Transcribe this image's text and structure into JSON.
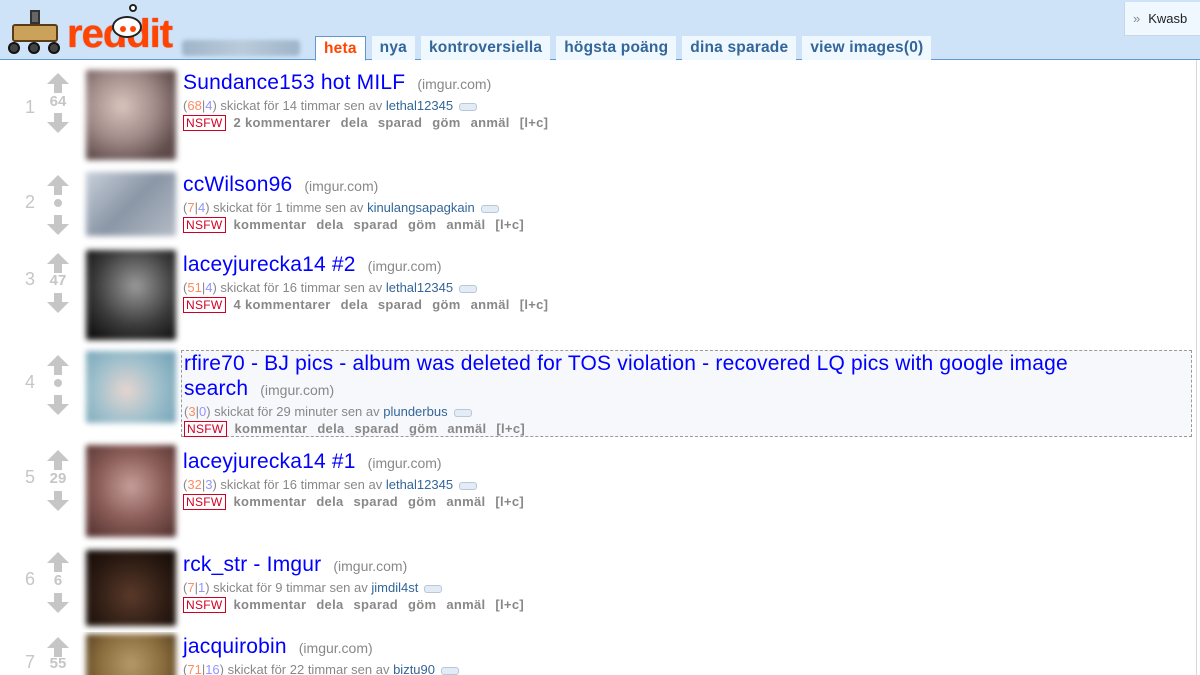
{
  "header": {
    "logo_text": "reddit",
    "tabs": [
      {
        "label": "heta",
        "selected": true
      },
      {
        "label": "nya",
        "selected": false
      },
      {
        "label": "kontroversiella",
        "selected": false
      },
      {
        "label": "högsta poäng",
        "selected": false
      },
      {
        "label": "dina sparade",
        "selected": false
      },
      {
        "label": "view images(0)",
        "selected": false
      }
    ],
    "user_chevron": "»",
    "user_name": "Kwasb"
  },
  "colors": {
    "header_bg": "#cee3f8",
    "link": "#0000ff",
    "nsfw": "#d10023",
    "selected_tab": "#ff4500"
  },
  "icons": {
    "upvote": "arrow-up-icon",
    "downvote": "arrow-down-icon",
    "flair": "tag-icon"
  },
  "posts": [
    {
      "rank": "1",
      "score": "64",
      "title": "Sundance153 hot MILF",
      "domain": "(imgur.com)",
      "ups": "68",
      "downs": "4",
      "time": "skickat för 14 timmar sen av",
      "author": "lethal12345",
      "nsfw": "NSFW",
      "comments": "2 kommentarer",
      "buttons": [
        "dela",
        "sparad",
        "göm",
        "anmäl",
        "[l+c]"
      ]
    },
    {
      "rank": "2",
      "score": "",
      "title": "ccWilson96",
      "domain": "(imgur.com)",
      "ups": "7",
      "downs": "4",
      "time": "skickat för 1 timme sen av",
      "author": "kinulangsapagkain",
      "nsfw": "NSFW",
      "comments": "kommentar",
      "buttons": [
        "dela",
        "sparad",
        "göm",
        "anmäl",
        "[l+c]"
      ]
    },
    {
      "rank": "3",
      "score": "47",
      "title": "laceyjurecka14 #2",
      "domain": "(imgur.com)",
      "ups": "51",
      "downs": "4",
      "time": "skickat för 16 timmar sen av",
      "author": "lethal12345",
      "nsfw": "NSFW",
      "comments": "4 kommentarer",
      "buttons": [
        "dela",
        "sparad",
        "göm",
        "anmäl",
        "[l+c]"
      ]
    },
    {
      "rank": "4",
      "score": "",
      "title_line1": "rfire70 - BJ pics - album was deleted for TOS violation - recovered LQ pics with google image",
      "title_line2": "search",
      "domain": "(imgur.com)",
      "ups": "3",
      "downs": "0",
      "time": "skickat för 29 minuter sen av",
      "author": "plunderbus",
      "nsfw": "NSFW",
      "comments": "kommentar",
      "buttons": [
        "dela",
        "sparad",
        "göm",
        "anmäl",
        "[l+c]"
      ]
    },
    {
      "rank": "5",
      "score": "29",
      "title": "laceyjurecka14 #1",
      "domain": "(imgur.com)",
      "ups": "32",
      "downs": "3",
      "time": "skickat för 16 timmar sen av",
      "author": "lethal12345",
      "nsfw": "NSFW",
      "comments": "kommentar",
      "buttons": [
        "dela",
        "sparad",
        "göm",
        "anmäl",
        "[l+c]"
      ]
    },
    {
      "rank": "6",
      "score": "6",
      "title": "rck_str - Imgur",
      "domain": "(imgur.com)",
      "ups": "7",
      "downs": "1",
      "time": "skickat för 9 timmar sen av",
      "author": "jimdil4st",
      "nsfw": "NSFW",
      "comments": "kommentar",
      "buttons": [
        "dela",
        "sparad",
        "göm",
        "anmäl",
        "[l+c]"
      ]
    },
    {
      "rank": "7",
      "score": "55",
      "title": "jacquirobin",
      "domain": "(imgur.com)",
      "ups": "71",
      "downs": "16",
      "time": "skickat för 22 timmar sen av",
      "author": "biztu90"
    }
  ]
}
